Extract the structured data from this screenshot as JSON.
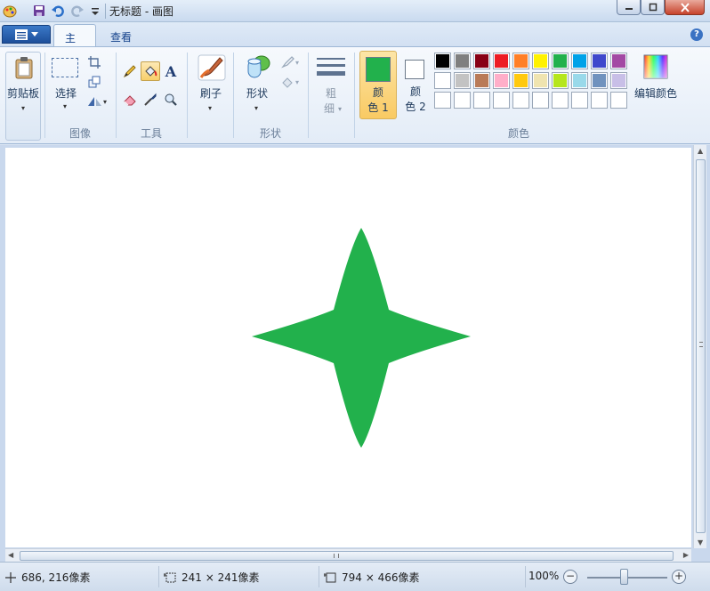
{
  "window": {
    "title": "无标题 - 画图"
  },
  "tabs": [
    {
      "label": "主页"
    },
    {
      "label": "查看"
    }
  ],
  "help_label": "?",
  "ribbon": {
    "clipboard": {
      "label": "剪贴板",
      "group_label": ""
    },
    "image": {
      "select_label": "选择",
      "group_label": "图像"
    },
    "tools": {
      "group_label": "工具",
      "text_tool": "A"
    },
    "brushes": {
      "label": "刷子"
    },
    "shapes": {
      "label": "形状",
      "group_label": "形状"
    },
    "size": {
      "label_line1": "粗",
      "label_line2": "细"
    },
    "colors": {
      "color1_line1": "颜",
      "color1_line2": "色 1",
      "color2_line1": "颜",
      "color2_line2": "色 2",
      "color1_value": "#22b14c",
      "color2_value": "#ffffff",
      "edit_label": "编辑颜色",
      "group_label": "颜色",
      "palette_row1": [
        "#000000",
        "#7f7f7f",
        "#880015",
        "#ed1c24",
        "#ff7f27",
        "#fff200",
        "#22b14c",
        "#00a2e8",
        "#3f48cc",
        "#a349a4"
      ],
      "palette_row2": [
        "#ffffff",
        "#c3c3c3",
        "#b97a57",
        "#ffaec9",
        "#ffc90e",
        "#efe4b0",
        "#b5e61d",
        "#99d9ea",
        "#7092be",
        "#c8bfe7"
      ],
      "palette_row3": [
        "#ffffff",
        "#ffffff",
        "#ffffff",
        "#ffffff",
        "#ffffff",
        "#ffffff",
        "#ffffff",
        "#ffffff",
        "#ffffff",
        "#ffffff"
      ]
    }
  },
  "canvas": {
    "shape": "four-point-star",
    "fill": "#22b14c"
  },
  "status": {
    "cursor_pos": "686, 216像素",
    "selection_size": "241 × 241像素",
    "image_size": "794 × 466像素",
    "zoom": "100%"
  }
}
